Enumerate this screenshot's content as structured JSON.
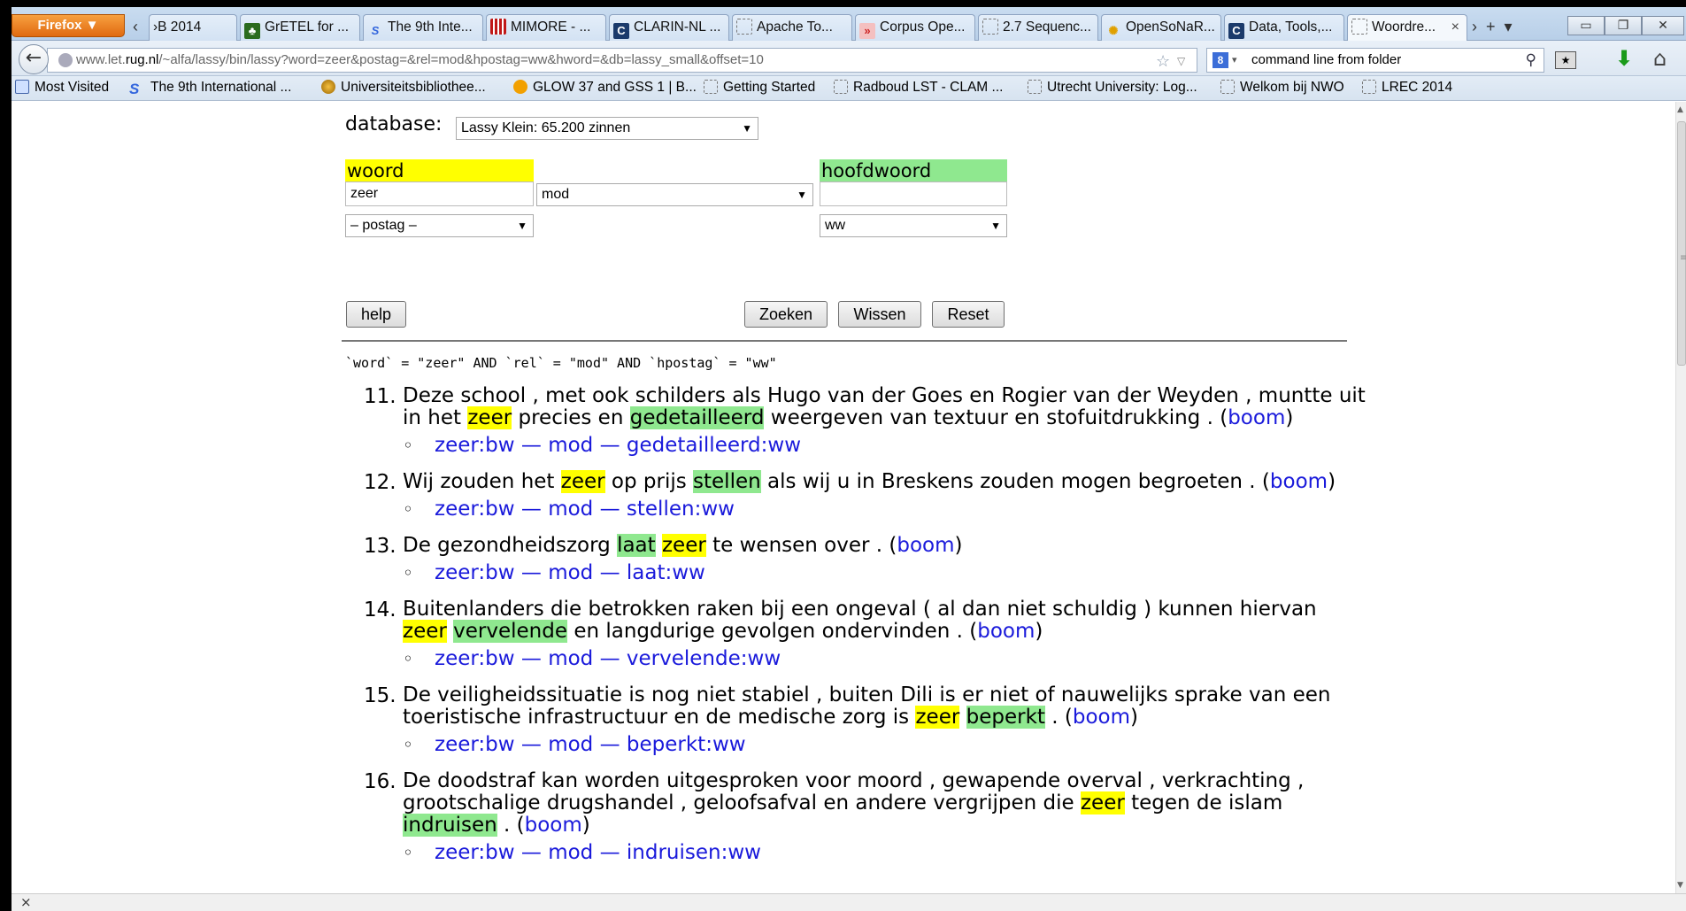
{
  "browser": {
    "menu_label": "Firefox ▼",
    "tabs": [
      {
        "label": "›B 2014",
        "icon": "scroll-left"
      },
      {
        "label": "GrETEL for ...",
        "icon": "tree-icon"
      },
      {
        "label": "The 9th Inte...",
        "icon": "s-icon"
      },
      {
        "label": "MIMORE - ...",
        "icon": "bars-icon"
      },
      {
        "label": "CLARIN-NL ...",
        "icon": "c-icon"
      },
      {
        "label": "Apache To...",
        "icon": "blank-icon"
      },
      {
        "label": "Corpus Ope...",
        "icon": "corpus-icon"
      },
      {
        "label": "2.7 Sequenc...",
        "icon": "blank-icon"
      },
      {
        "label": "OpenSoNaR...",
        "icon": "star-burst-icon"
      },
      {
        "label": "Data, Tools,...",
        "icon": "c-icon"
      },
      {
        "label": "Woordre...",
        "icon": "blank-icon"
      }
    ],
    "url_prefix": "www.let.",
    "url_host": "rug.nl",
    "url_path": "/~alfa/lassy/bin/lassy?word=zeer&postag=&rel=mod&hpostag=ww&hword=&db=lassy_small&offset=10",
    "search_value": "command line from folder",
    "bookmarks": [
      "Most Visited",
      "The 9th International ...",
      "Universiteitsbibliothee...",
      "GLOW 37 and GSS 1 | B...",
      "Getting Started",
      "Radboud LST - CLAM ...",
      "Utrecht University: Log...",
      "Welkom bij NWO",
      "LREC 2014"
    ]
  },
  "form": {
    "database_label": "database:",
    "database_value": "Lassy Klein: 65.200 zinnen",
    "woord_label": "woord",
    "hoofdwoord_label": "hoofdwoord",
    "word_value": "zeer",
    "rel_value": "mod",
    "hword_value": "",
    "postag_value": "– postag –",
    "hpostag_value": "ww",
    "help_label": "help",
    "zoeken_label": "Zoeken",
    "wissen_label": "Wissen",
    "reset_label": "Reset"
  },
  "query": "`word` = \"zeer\" AND `rel` = \"mod\" AND `hpostag` = \"ww\"",
  "colors": {
    "word_highlight": "#ffff00",
    "head_highlight": "#8fe88f",
    "link": "#1a1adb"
  },
  "results": [
    {
      "num": "11.",
      "before": "Deze school , met ook schilders als Hugo van der Goes en Rogier van der Weyden , muntte uit in het ",
      "first": "zeer",
      "first_color": "yellow",
      "middle": " precies en ",
      "second": "gedetailleerd",
      "second_color": "green",
      "after": " weergeven van textuur en stofuitdrukking . (",
      "link": "boom",
      "tail": ")",
      "dep": "zeer:bw — mod — gedetailleerd:ww"
    },
    {
      "num": "12.",
      "before": "Wij zouden het ",
      "first": "zeer",
      "first_color": "yellow",
      "middle": " op prijs ",
      "second": "stellen",
      "second_color": "green",
      "after": " als wij u in Breskens zouden mogen begroeten . (",
      "link": "boom",
      "tail": ")",
      "dep": "zeer:bw — mod — stellen:ww"
    },
    {
      "num": "13.",
      "before": "De gezondheidszorg ",
      "first": "laat",
      "first_color": "green",
      "middle": " ",
      "second": "zeer",
      "second_color": "yellow",
      "after": " te wensen over . (",
      "link": "boom",
      "tail": ")",
      "dep": "zeer:bw — mod — laat:ww"
    },
    {
      "num": "14.",
      "before": "Buitenlanders die betrokken raken bij een ongeval ( al dan niet schuldig ) kunnen hiervan ",
      "first": "zeer",
      "first_color": "yellow",
      "middle": " ",
      "second": "vervelende",
      "second_color": "green",
      "after": " en langdurige gevolgen ondervinden . (",
      "link": "boom",
      "tail": ")",
      "dep": "zeer:bw — mod — vervelende:ww"
    },
    {
      "num": "15.",
      "before": "De veiligheidssituatie is nog niet stabiel , buiten Dili is er niet of nauwelijks sprake van een toeristische infrastructuur en de medische zorg is ",
      "first": "zeer",
      "first_color": "yellow",
      "middle": " ",
      "second": "beperkt",
      "second_color": "green",
      "after": " . (",
      "link": "boom",
      "tail": ")",
      "dep": "zeer:bw — mod — beperkt:ww"
    },
    {
      "num": "16.",
      "before": "De doodstraf kan worden uitgesproken voor moord , gewapende overval , verkrachting , grootschalige drugshandel , geloofsafval en andere vergrijpen die ",
      "first": "zeer",
      "first_color": "yellow",
      "middle": " tegen de islam ",
      "second": "indruisen",
      "second_color": "green",
      "after": " . (",
      "link": "boom",
      "tail": ")",
      "dep": "zeer:bw — mod — indruisen:ww"
    }
  ]
}
